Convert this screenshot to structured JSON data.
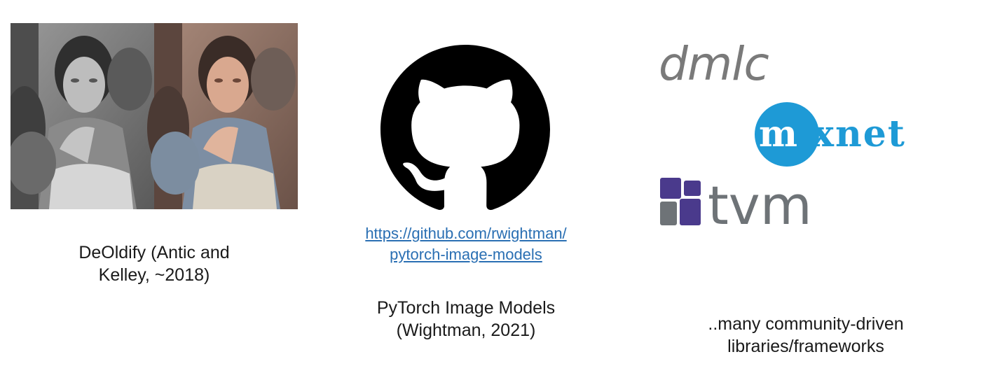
{
  "left": {
    "caption_line1": "DeOldify (Antic and",
    "caption_line2": "Kelley, ~2018)"
  },
  "middle": {
    "link_line1": "https://github.com/rwightman/",
    "link_line2": "pytorch-image-models",
    "caption_line1": "PyTorch Image Models",
    "caption_line2": "(Wightman, 2021)",
    "logo_icon": "github-octocat-icon"
  },
  "right": {
    "dmlc_logo_text": "dmlc",
    "mxnet_logo_text": "mxnet",
    "tvm_logo_text": "tvm",
    "caption_line1": "..many community-driven",
    "caption_line2": "libraries/frameworks"
  },
  "colors": {
    "link": "#2a6fb3",
    "mxnet_blue": "#1e9ad6",
    "tvm_purple": "#4a3a8c",
    "tvm_gray": "#6e7377",
    "dmlc_gray": "#7a7a7a"
  }
}
